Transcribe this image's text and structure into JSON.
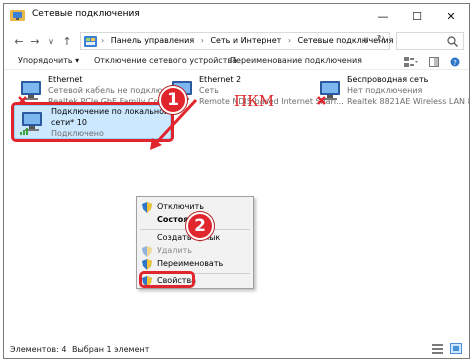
{
  "window": {
    "title": "Сетевые подключения",
    "minimize_glyph": "—",
    "maximize_glyph": "☐",
    "close_glyph": "✕"
  },
  "address": {
    "crumbs": [
      "Панель управления",
      "Сеть и Интернет",
      "Сетевые подключения"
    ],
    "separator": "›",
    "dropdown_glyph": "∨",
    "refresh_glyph": "↻"
  },
  "nav": {
    "back": "←",
    "forward": "→",
    "recent": "∨",
    "up": "↑"
  },
  "toolbar": {
    "organize": "Упорядочить ▾",
    "disable": "Отключение сетевого устройства",
    "rename": "Переименование подключения"
  },
  "connections": [
    {
      "name": "Ethernet",
      "status": "Сетевой кабель не подключен",
      "adapter": "Realtek PCIe GbE Family Controller"
    },
    {
      "name": "Ethernet 2",
      "status": "Сеть",
      "adapter": "Remote NDIS based Internet Shari..."
    },
    {
      "name": "Беспроводная сеть",
      "status": "Нет подключения",
      "adapter": "Realtek 8821AE Wireless LAN 802..."
    },
    {
      "name_line1": "Подключение по локальной",
      "name_line2": "сети* 10",
      "status": "Подключено"
    }
  ],
  "context_menu": {
    "items": [
      {
        "label": "Отключить",
        "shield": true,
        "bold": false,
        "disabled": false
      },
      {
        "label": "Состояние",
        "shield": false,
        "bold": true,
        "disabled": false
      },
      {
        "label": "Создать ярлык",
        "shield": false,
        "bold": false,
        "disabled": false
      },
      {
        "label": "Удалить",
        "shield": true,
        "bold": false,
        "disabled": true
      },
      {
        "label": "Переименовать",
        "shield": true,
        "bold": false,
        "disabled": false
      },
      {
        "label": "Свойства",
        "shield": true,
        "bold": false,
        "disabled": false
      }
    ]
  },
  "annotations": {
    "step1": "1",
    "step2": "2",
    "right_click": "ПКМ"
  },
  "statusbar": {
    "count": "Элементов: 4",
    "selected": "Выбран 1 элемент"
  },
  "colors": {
    "highlight_red": "#e0262c",
    "selection_bg": "#cce8ff",
    "menu_bg": "#f2f2f2"
  }
}
